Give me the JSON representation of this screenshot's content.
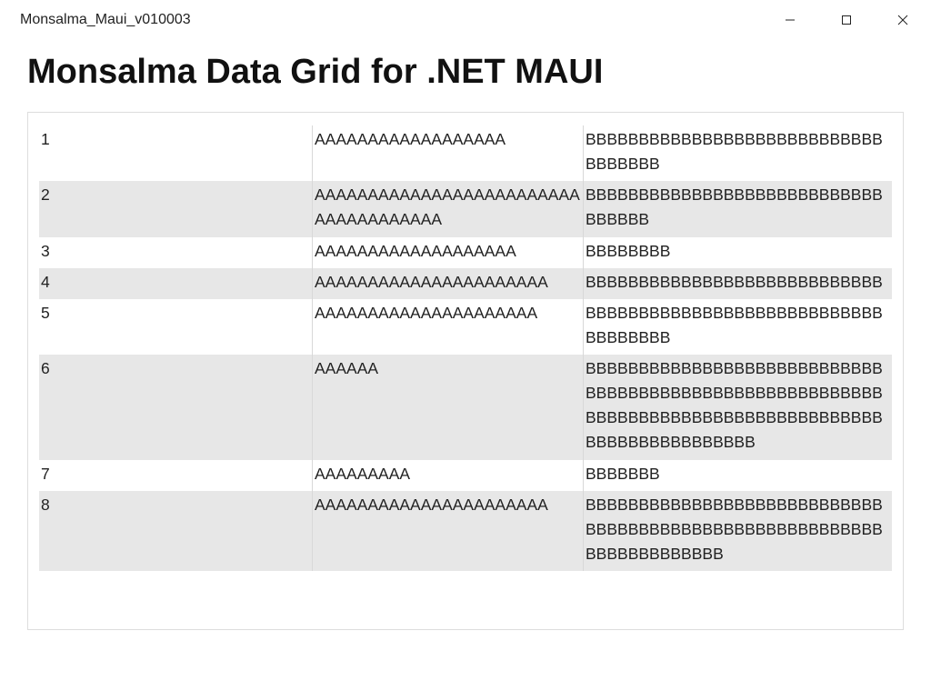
{
  "window": {
    "title": "Monsalma_Maui_v010003"
  },
  "header": {
    "title": "Monsalma Data Grid for .NET MAUI"
  },
  "grid": {
    "rows": [
      {
        "id": "1",
        "a": "AAAAAAAAAAAAAAAAAA",
        "b": "BBBBBBBBBBBBBBBBBBBBBBBBBBBBBBBBBBB"
      },
      {
        "id": "2",
        "a": "AAAAAAAAAAAAAAAAAAAAAAAAAAAAAAAAAAAAA",
        "b": "BBBBBBBBBBBBBBBBBBBBBBBBBBBBBBBBBB"
      },
      {
        "id": "3",
        "a": "AAAAAAAAAAAAAAAAAAA",
        "b": "BBBBBBBB"
      },
      {
        "id": "4",
        "a": "AAAAAAAAAAAAAAAAAAAAAA",
        "b": "BBBBBBBBBBBBBBBBBBBBBBBBBBBB"
      },
      {
        "id": "5",
        "a": "AAAAAAAAAAAAAAAAAAAAA",
        "b": "BBBBBBBBBBBBBBBBBBBBBBBBBBBBBBBBBBBB"
      },
      {
        "id": "6",
        "a": "AAAAAA",
        "b": "BBBBBBBBBBBBBBBBBBBBBBBBBBBBBBBBBBBBBBBBBBBBBBBBBBBBBBBBBBBBBBBBBBBBBBBBBBBBBBBBBBBBBBBBBBBBBBBBBBBB"
      },
      {
        "id": "7",
        "a": "AAAAAAAAA",
        "b": "BBBBBBB"
      },
      {
        "id": "8",
        "a": "AAAAAAAAAAAAAAAAAAAAAA",
        "b": "BBBBBBBBBBBBBBBBBBBBBBBBBBBBBBBBBBBBBBBBBBBBBBBBBBBBBBBBBBBBBBBBBBBBB"
      }
    ]
  }
}
